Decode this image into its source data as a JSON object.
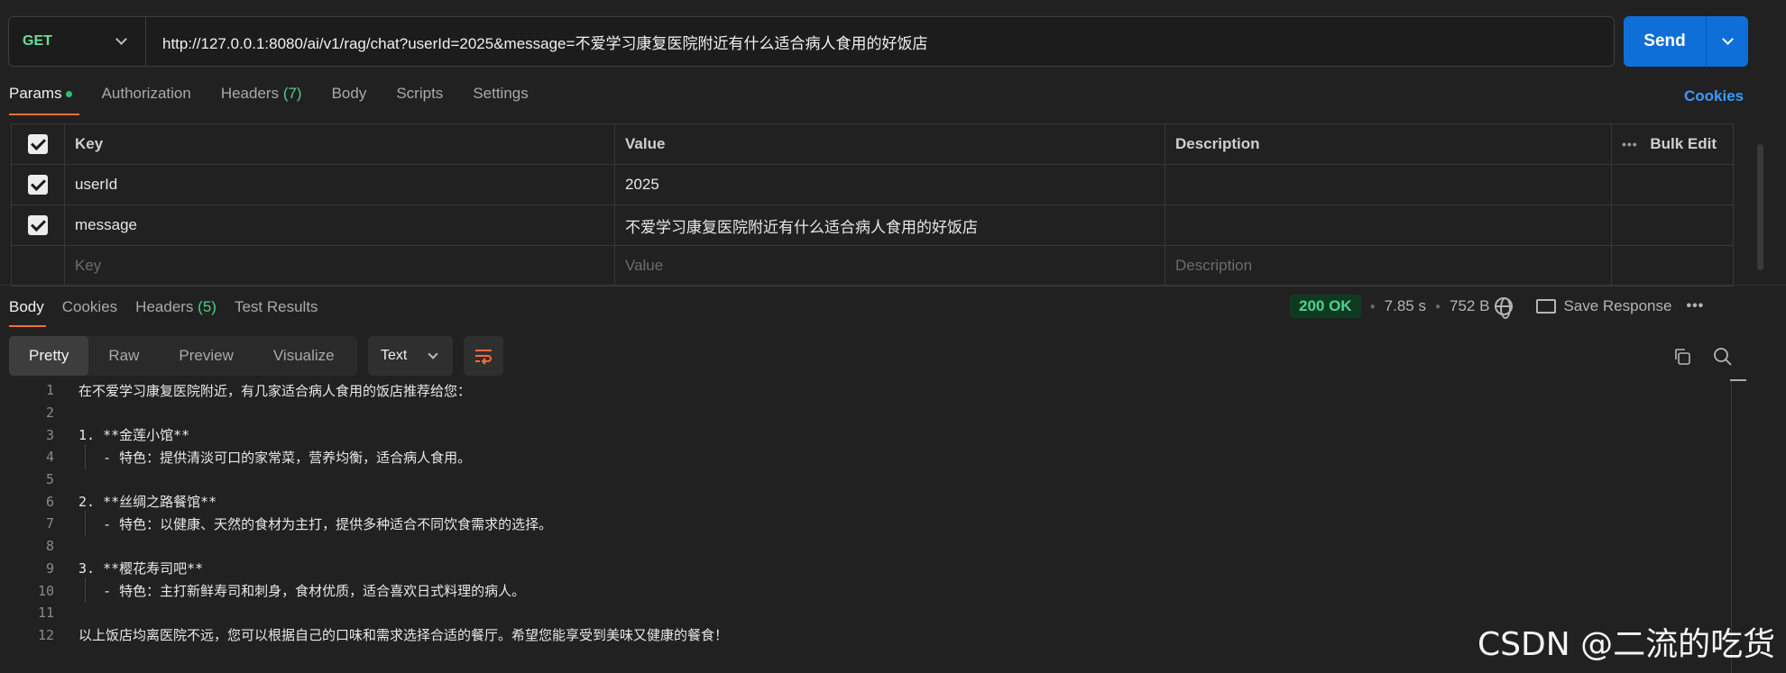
{
  "request": {
    "method": "GET",
    "url": "http://127.0.0.1:8080/ai/v1/rag/chat?userId=2025&message=不爱学习康复医院附近有什么适合病人食用的好饭店",
    "send_label": "Send"
  },
  "req_tabs": {
    "params": "Params",
    "authorization": "Authorization",
    "headers": "Headers",
    "headers_count": "(7)",
    "body": "Body",
    "scripts": "Scripts",
    "settings": "Settings",
    "cookies": "Cookies"
  },
  "params_table": {
    "headers": {
      "key": "Key",
      "value": "Value",
      "description": "Description",
      "bulk_edit": "Bulk Edit"
    },
    "rows": [
      {
        "key": "userId",
        "value": "2025",
        "description": ""
      },
      {
        "key": "message",
        "value": "不爱学习康复医院附近有什么适合病人食用的好饭店",
        "description": ""
      }
    ],
    "placeholder": {
      "key": "Key",
      "value": "Value",
      "description": "Description"
    }
  },
  "resp_tabs": {
    "body": "Body",
    "cookies": "Cookies",
    "headers": "Headers",
    "headers_count": "(5)",
    "test_results": "Test Results"
  },
  "response_meta": {
    "status": "200 OK",
    "time": "7.85 s",
    "size": "752 B",
    "save_response": "Save Response"
  },
  "view_modes": {
    "pretty": "Pretty",
    "raw": "Raw",
    "preview": "Preview",
    "visualize": "Visualize"
  },
  "format": "Text",
  "body_lines": [
    {
      "n": "1",
      "text": "在不爱学习康复医院附近，有几家适合病人食用的饭店推荐给您："
    },
    {
      "n": "2",
      "text": ""
    },
    {
      "n": "3",
      "text": "1. **金莲小馆**"
    },
    {
      "n": "4",
      "text": "   - 特色：提供清淡可口的家常菜，营养均衡，适合病人食用。"
    },
    {
      "n": "5",
      "text": ""
    },
    {
      "n": "6",
      "text": "2. **丝绸之路餐馆**"
    },
    {
      "n": "7",
      "text": "   - 特色：以健康、天然的食材为主打，提供多种适合不同饮食需求的选择。"
    },
    {
      "n": "8",
      "text": ""
    },
    {
      "n": "9",
      "text": "3. **樱花寿司吧**"
    },
    {
      "n": "10",
      "text": "   - 特色：主打新鲜寿司和刺身，食材优质，适合喜欢日式料理的病人。"
    },
    {
      "n": "11",
      "text": ""
    },
    {
      "n": "12",
      "text": "以上饭店均离医院不远，您可以根据自己的口味和需求选择合适的餐厅。希望您能享受到美味又健康的餐食！"
    }
  ],
  "watermark": "CSDN @二流的吃货",
  "colors": {
    "accent": "#ff6c37",
    "send": "#0f6fd9",
    "method": "#6bdd9a",
    "status": "#4fd08b",
    "link": "#3a9bff"
  }
}
